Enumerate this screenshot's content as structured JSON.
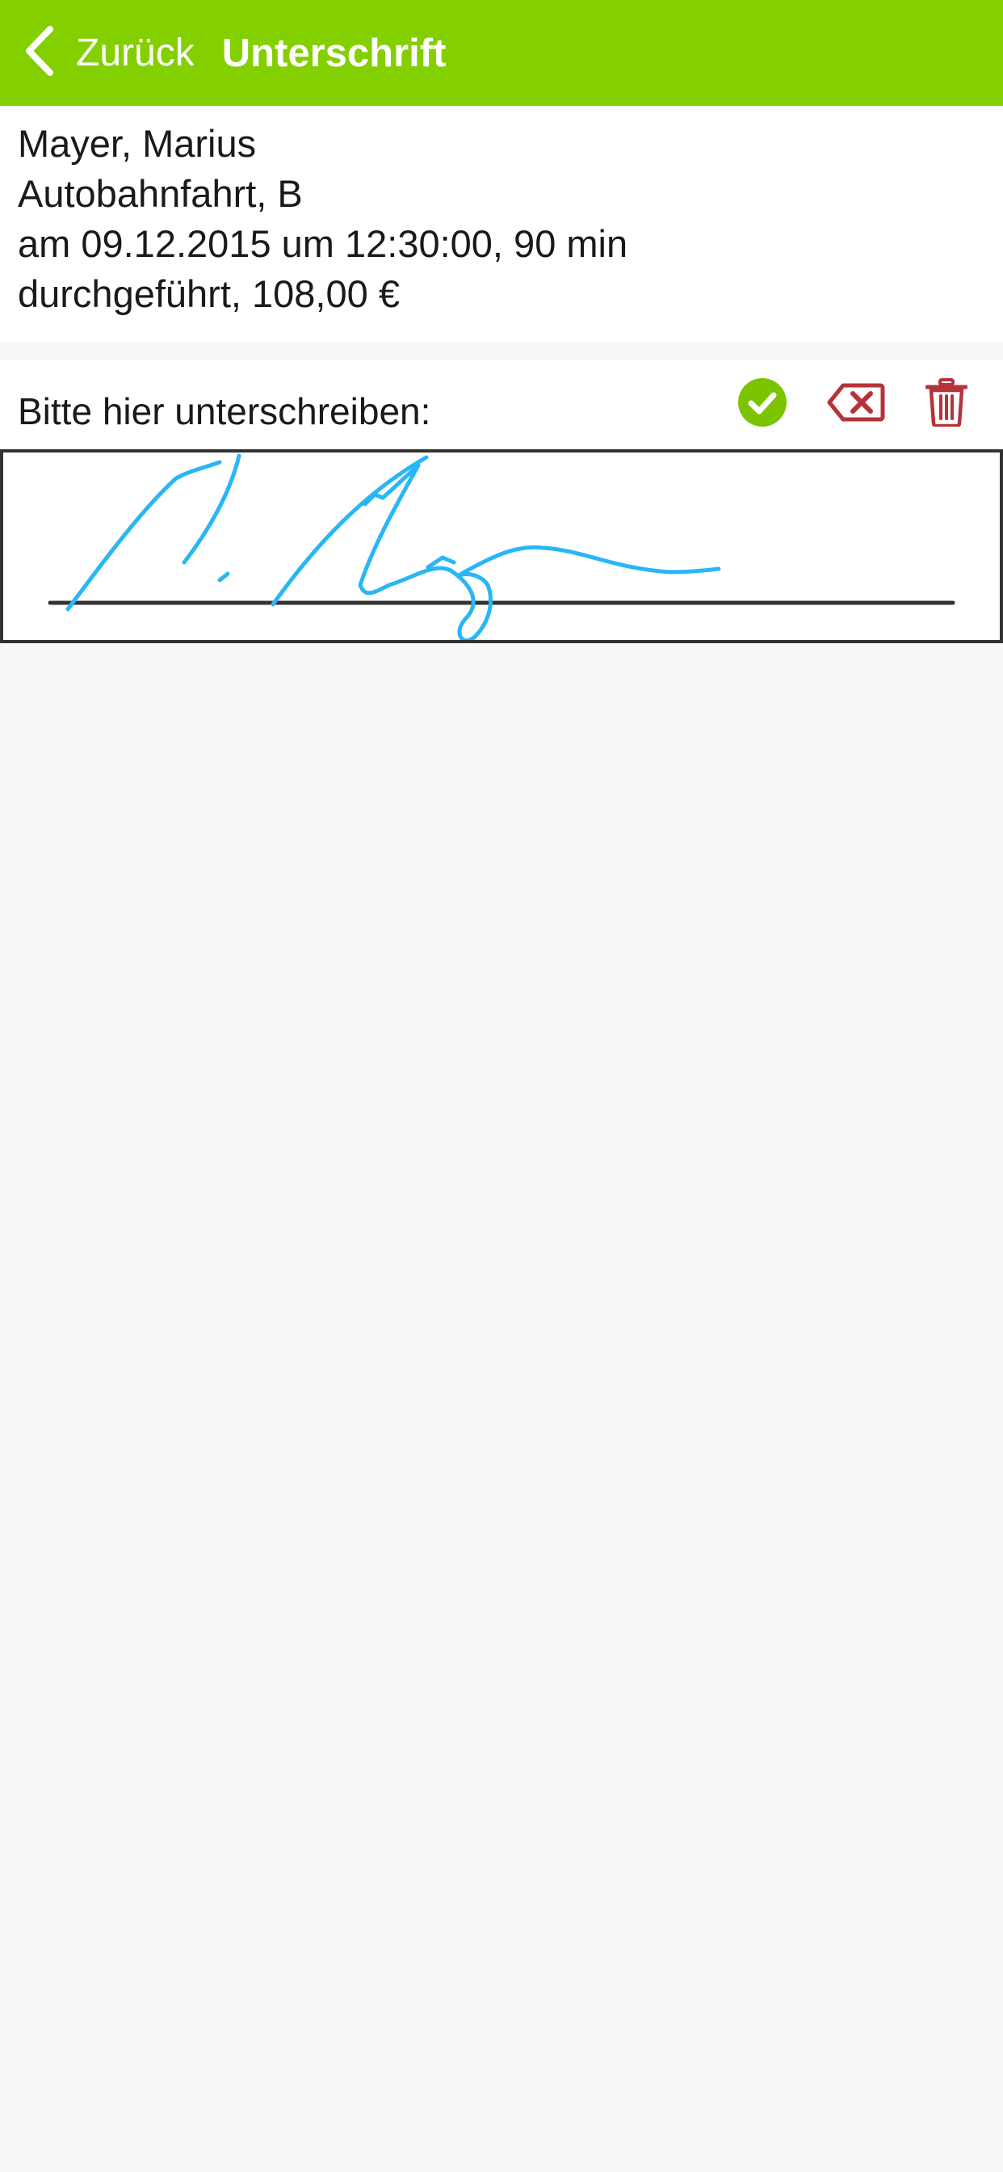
{
  "header": {
    "back_label": "Zurück",
    "title": "Unterschrift"
  },
  "info": {
    "name": "Mayer, Marius",
    "lesson": "Autobahnfahrt, B",
    "datetime": "am 09.12.2015 um 12:30:00, 90 min",
    "status": "durchgeführt, 108,00 €"
  },
  "signature": {
    "prompt": "Bitte hier unterschreiben:",
    "accept_icon": "check-circle-icon",
    "clear_icon": "backspace-icon",
    "delete_icon": "trash-icon"
  },
  "colors": {
    "header_bg": "#84cf00",
    "accept": "#7cc400",
    "danger": "#b5333a",
    "ink": "#29b6f6",
    "background": "#f8f8f8"
  }
}
